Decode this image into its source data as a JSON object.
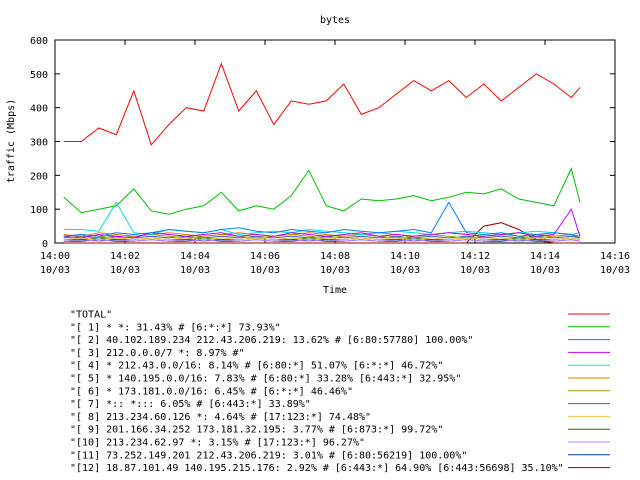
{
  "chart_data": {
    "type": "line",
    "title": "bytes",
    "xlabel": "Time",
    "ylabel": "traffic (Mbps)",
    "ylim": [
      0,
      600
    ],
    "yticks": [
      "0",
      "100",
      "200",
      "300",
      "400",
      "500",
      "600"
    ],
    "xlim": [
      "14:00",
      "14:16"
    ],
    "xticks": [
      {
        "t": "14:00",
        "l1": "14:00",
        "l2": "10/03"
      },
      {
        "t": "14:02",
        "l1": "14:02",
        "l2": "10/03"
      },
      {
        "t": "14:04",
        "l1": "14:04",
        "l2": "10/03"
      },
      {
        "t": "14:06",
        "l1": "14:06",
        "l2": "10/03"
      },
      {
        "t": "14:08",
        "l1": "14:08",
        "l2": "10/03"
      },
      {
        "t": "14:10",
        "l1": "14:10",
        "l2": "10/03"
      },
      {
        "t": "14:12",
        "l1": "14:12",
        "l2": "10/03"
      },
      {
        "t": "14:14",
        "l1": "14:14",
        "l2": "10/03"
      },
      {
        "t": "14:16",
        "l1": "14:16",
        "l2": "10/03"
      }
    ],
    "grid": false,
    "legend_position": "bottom",
    "x": [
      "14:00:15",
      "14:00:45",
      "14:01:15",
      "14:01:45",
      "14:02:15",
      "14:02:45",
      "14:03:15",
      "14:03:45",
      "14:04:15",
      "14:04:45",
      "14:05:15",
      "14:05:45",
      "14:06:15",
      "14:06:45",
      "14:07:15",
      "14:07:45",
      "14:08:15",
      "14:08:45",
      "14:09:15",
      "14:09:45",
      "14:10:15",
      "14:10:45",
      "14:11:15",
      "14:11:45",
      "14:12:15",
      "14:12:45",
      "14:13:15",
      "14:13:45",
      "14:14:15",
      "14:14:45",
      "14:15:00"
    ],
    "series": [
      {
        "name": "\"TOTAL\"",
        "color": "#ff0000",
        "values": [
          300,
          300,
          340,
          320,
          450,
          290,
          350,
          400,
          390,
          530,
          390,
          450,
          350,
          420,
          410,
          420,
          470,
          380,
          400,
          440,
          480,
          450,
          480,
          430,
          470,
          420,
          460,
          500,
          470,
          430,
          460
        ]
      },
      {
        "name": "\"[ 1] * *: 31.43% # [6:*:*] 73.93%\"",
        "color": "#00c000",
        "values": [
          135,
          90,
          100,
          110,
          160,
          95,
          85,
          100,
          110,
          150,
          95,
          110,
          100,
          140,
          215,
          110,
          95,
          130,
          125,
          130,
          140,
          125,
          135,
          150,
          145,
          160,
          130,
          120,
          110,
          220,
          120
        ]
      },
      {
        "name": "\"[ 2] 40.102.189.234 212.43.206.219: 13.62% # [6:80:57780] 100.00%\"",
        "color": "#0080ff",
        "values": [
          20,
          25,
          20,
          30,
          25,
          30,
          40,
          35,
          30,
          40,
          45,
          35,
          30,
          40,
          35,
          30,
          40,
          35,
          30,
          35,
          40,
          30,
          120,
          30,
          25,
          30,
          20,
          25,
          30,
          25,
          15
        ]
      },
      {
        "name": "\"[ 3] 212.0.0.0/7 *: 8.97% #\"",
        "color": "#c000ff",
        "values": [
          20,
          15,
          25,
          20,
          15,
          30,
          25,
          20,
          25,
          30,
          20,
          25,
          20,
          30,
          25,
          20,
          25,
          30,
          20,
          25,
          20,
          25,
          30,
          25,
          20,
          25,
          30,
          20,
          25,
          100,
          20
        ]
      },
      {
        "name": "\"[ 4] * 212.43.0.0/16: 8.14% # [6:80:*] 51.07% [6:*:*] 46.72%\"",
        "color": "#00e0e0",
        "values": [
          40,
          40,
          35,
          120,
          30,
          25,
          40,
          35,
          30,
          40,
          25,
          30,
          35,
          30,
          40,
          35,
          30,
          25,
          30,
          35,
          30,
          25,
          30,
          35,
          30,
          25,
          30,
          35,
          30,
          25,
          30
        ]
      },
      {
        "name": "\"[ 5] * 140.195.0.0/16: 7.83% # [6:80:*] 33.28% [6:443:*] 32.95%\"",
        "color": "#e08000",
        "values": [
          25,
          20,
          30,
          25,
          20,
          25,
          30,
          25,
          20,
          25,
          30,
          25,
          20,
          25,
          30,
          25,
          20,
          25,
          30,
          25,
          20,
          25,
          30,
          25,
          20,
          25,
          30,
          25,
          20,
          25,
          20
        ]
      },
      {
        "name": "\"[ 6] * 173.181.0.0/16: 6.45% # [6:*:*] 46.46%\"",
        "color": "#a0a000",
        "values": [
          20,
          25,
          20,
          15,
          20,
          25,
          20,
          15,
          20,
          25,
          20,
          15,
          20,
          25,
          20,
          15,
          20,
          25,
          20,
          15,
          20,
          25,
          20,
          15,
          20,
          25,
          20,
          15,
          20,
          25,
          20
        ]
      },
      {
        "name": "\"[ 7] *:: *::: 6.05% # [6:443:*] 33.89%\"",
        "color": "#4060c0",
        "values": [
          15,
          20,
          15,
          20,
          15,
          20,
          15,
          20,
          15,
          20,
          15,
          20,
          15,
          20,
          15,
          20,
          15,
          20,
          15,
          20,
          15,
          20,
          15,
          20,
          15,
          20,
          15,
          20,
          15,
          20,
          15
        ]
      },
      {
        "name": "\"[ 8] 213.234.60.126 *: 4.64% # [17:123:*] 74.48%\"",
        "color": "#f0c040",
        "values": [
          10,
          15,
          10,
          15,
          10,
          15,
          10,
          15,
          10,
          15,
          10,
          15,
          10,
          15,
          10,
          15,
          10,
          15,
          10,
          15,
          10,
          15,
          10,
          15,
          10,
          15,
          10,
          15,
          10,
          15,
          10
        ]
      },
      {
        "name": "\"[ 9] 201.166.34.252 173.181.32.195: 3.77% # [6:873:*] 99.72%\"",
        "color": "#008000",
        "values": [
          10,
          10,
          15,
          10,
          10,
          15,
          10,
          10,
          15,
          10,
          10,
          15,
          10,
          10,
          15,
          10,
          10,
          15,
          10,
          10,
          15,
          10,
          10,
          15,
          10,
          10,
          15,
          10,
          10,
          15,
          10
        ]
      },
      {
        "name": "\"[10] 213.234.62.97 *: 3.15% # [17:123:*] 96.27%\"",
        "color": "#c080ff",
        "values": [
          5,
          10,
          5,
          10,
          5,
          10,
          5,
          10,
          5,
          10,
          5,
          10,
          5,
          10,
          5,
          10,
          5,
          10,
          5,
          10,
          5,
          10,
          5,
          10,
          5,
          10,
          5,
          10,
          5,
          10,
          5
        ]
      },
      {
        "name": "\"[11] 73.252.149.201 212.43.206.219: 3.01% # [6:80:56219] 100.00%\"",
        "color": "#0040a0",
        "values": [
          5,
          5,
          10,
          5,
          5,
          10,
          5,
          5,
          10,
          5,
          5,
          10,
          5,
          5,
          10,
          5,
          5,
          10,
          5,
          5,
          10,
          5,
          5,
          10,
          5,
          5,
          10,
          5,
          5,
          10,
          5
        ]
      },
      {
        "name": "\"[12] 18.87.101.49 140.195.215.176: 2.92% # [6:443:*] 64.90% [6:443:56698] 35.10%\"",
        "color": "#a00000",
        "values": [
          0,
          0,
          0,
          0,
          0,
          0,
          0,
          0,
          0,
          0,
          0,
          0,
          0,
          0,
          0,
          0,
          0,
          0,
          0,
          0,
          0,
          0,
          0,
          0,
          50,
          60,
          40,
          10,
          0,
          0,
          0
        ]
      }
    ]
  }
}
